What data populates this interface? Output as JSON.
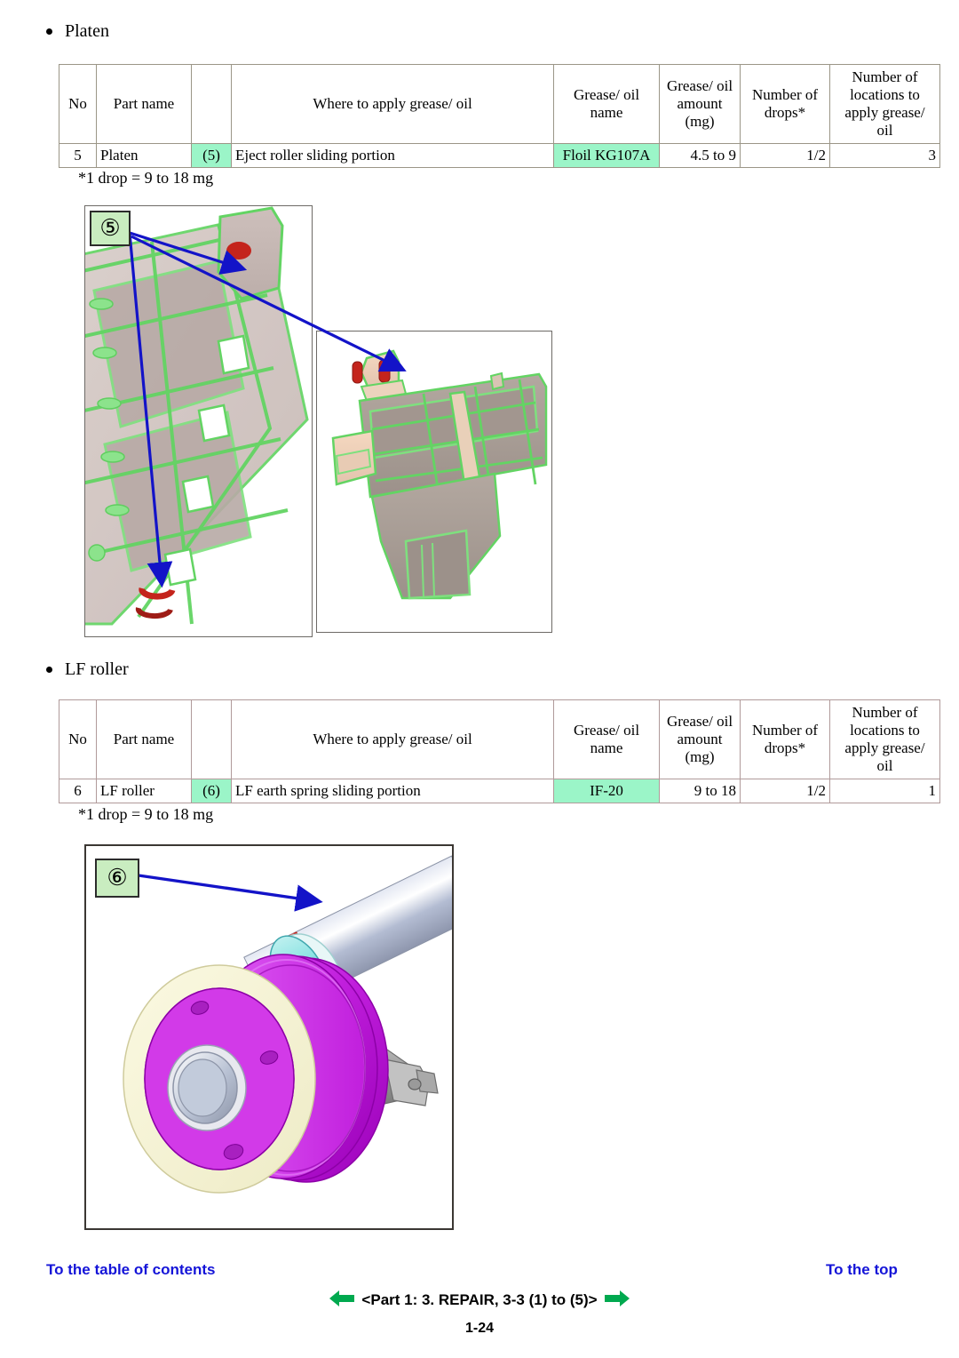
{
  "sections": [
    {
      "heading": "Platen",
      "table": {
        "headers": {
          "no": "No",
          "part_name": "Part name",
          "ref": "",
          "where": "Where to apply grease/ oil",
          "grease_name": "Grease/ oil name",
          "grease_amount": "Grease/ oil amount (mg)",
          "drops": "Number of drops*",
          "locations": "Number of locations to apply grease/ oil"
        },
        "rows": [
          {
            "no": "5",
            "part_name": "Platen",
            "ref": "(5)",
            "where": "Eject roller sliding portion",
            "grease_name": "Floil KG107A",
            "grease_amount": "4.5 to 9",
            "drops": "1/2",
            "locations": "3"
          }
        ]
      },
      "footnote": "*1 drop = 9 to 18 mg",
      "callout": "⑤"
    },
    {
      "heading": "LF roller",
      "table": {
        "headers": {
          "no": "No",
          "part_name": "Part name",
          "ref": "",
          "where": "Where to apply grease/ oil",
          "grease_name": "Grease/ oil name",
          "grease_amount": "Grease/ oil amount (mg)",
          "drops": "Number of drops*",
          "locations": "Number of locations to apply grease/ oil"
        },
        "rows": [
          {
            "no": "6",
            "part_name": "LF roller",
            "ref": "(6)",
            "where": "LF earth spring sliding portion",
            "grease_name": "IF-20",
            "grease_amount": "9 to 18",
            "drops": "1/2",
            "locations": "1"
          }
        ]
      },
      "footnote": "*1 drop = 9 to 18 mg",
      "callout": "⑥"
    }
  ],
  "header_lines": {
    "grease_name_l1": "Grease/ oil",
    "grease_name_l2": "name",
    "grease_amount_l1": "Grease/ oil",
    "grease_amount_l2": "amount",
    "grease_amount_l3": "(mg)",
    "drops_l1": "Number of",
    "drops_l2": "drops*",
    "locations_l1": "Number of",
    "locations_l2": "locations to",
    "locations_l3": "apply grease/",
    "locations_l4": "oil"
  },
  "footer": {
    "toc_label": "To the table of contents",
    "top_label": "To the top",
    "nav_label": "<Part 1:  3. REPAIR, 3-3 (1) to (5)>",
    "page_number": "1-24",
    "link_color": "#1414d8",
    "arrow_color": "#00a94f"
  },
  "colors": {
    "highlight_green": "#9bf5c8",
    "callout_green": "#c9edc0",
    "arrow_blue": "#1313c8",
    "grease_red": "#c4241c",
    "part_green": "#5fd45f",
    "roller_magenta": "#c520e0",
    "roller_cream": "#f2f0d0",
    "shaft_grey": "#b9c0d2",
    "collar_cyan": "#7fdede"
  }
}
